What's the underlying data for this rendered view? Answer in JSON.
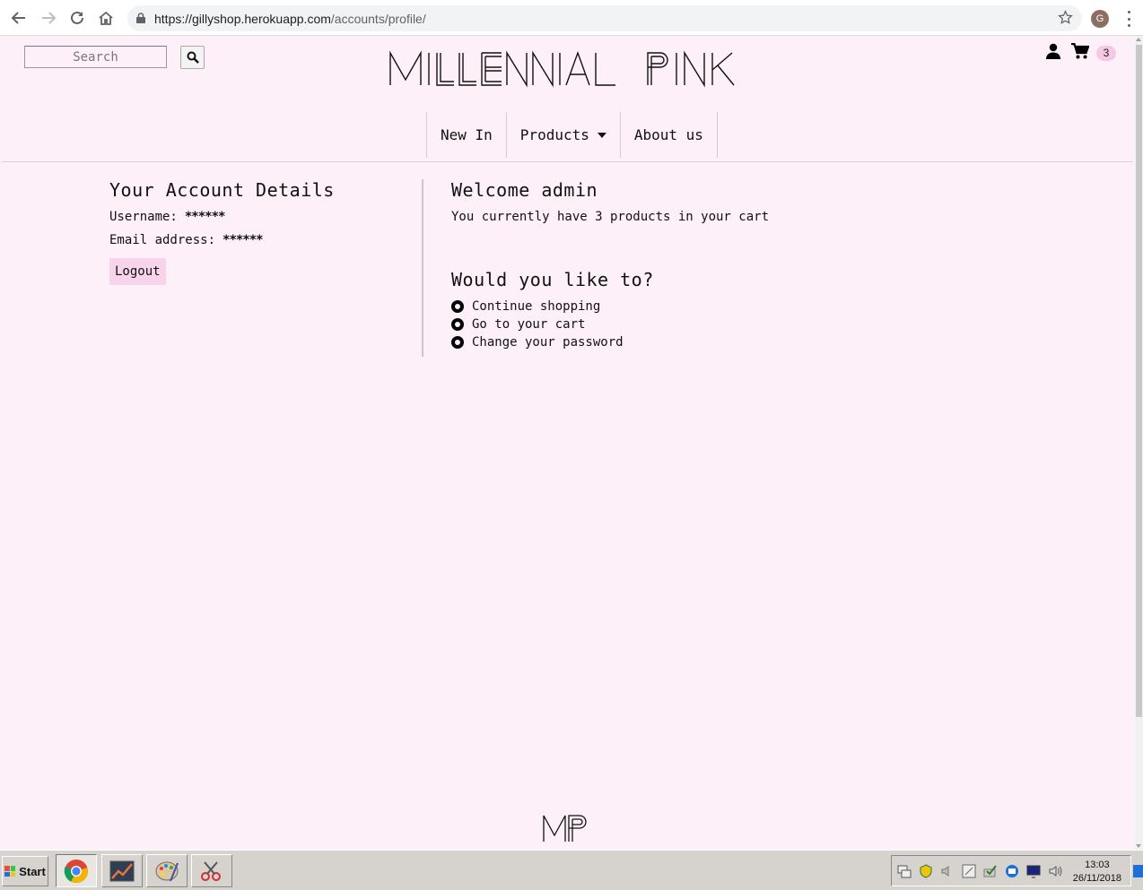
{
  "browser": {
    "url_host": "https://gillyshop.herokuapp.com",
    "url_path": "/accounts/profile/",
    "profile_initial": "G"
  },
  "header": {
    "search": {
      "placeholder": "Search"
    },
    "logo_text": "MILLENNIAL PINK",
    "cart_count": "3"
  },
  "nav": {
    "items": [
      {
        "label": "New In"
      },
      {
        "label": "Products"
      },
      {
        "label": "About us"
      }
    ]
  },
  "account": {
    "title": "Your Account Details",
    "username_label": "Username:",
    "username_value": "******",
    "email_label": "Email address:",
    "email_value": "******",
    "logout_label": "Logout"
  },
  "welcome": {
    "title": "Welcome admin",
    "cart_message": "You currently have 3 products in your cart",
    "options_title": "Would you like to?",
    "options": [
      {
        "label": "Continue shopping"
      },
      {
        "label": "Go to your cart"
      },
      {
        "label": "Change your password"
      }
    ]
  },
  "footer": {
    "logo_text": "MP"
  },
  "taskbar": {
    "start_label": "Start",
    "clock_time": "13:03",
    "clock_date": "26/11/2018"
  },
  "colors": {
    "page_background": "#fdf0f8",
    "accent_pink": "#f7d4ea",
    "badge_pink": "#f7c8e4"
  }
}
